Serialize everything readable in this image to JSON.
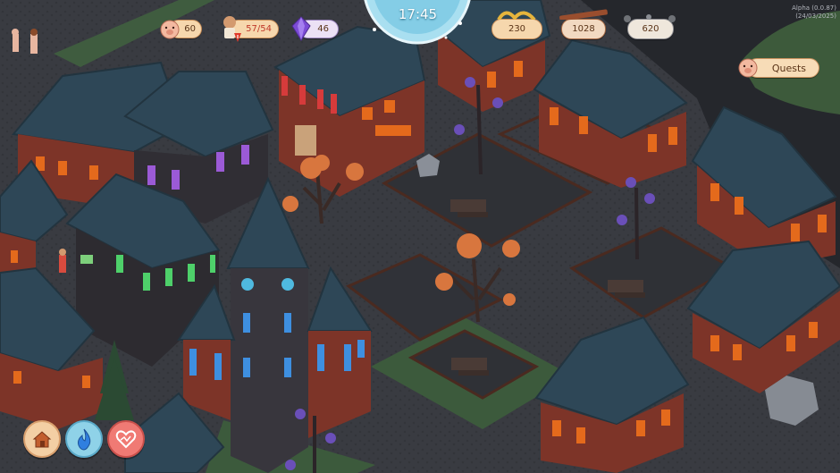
{
  "clock": {
    "time": "17:45"
  },
  "resources": {
    "population": {
      "icon": "pig-face-icon",
      "value": "60"
    },
    "workers": {
      "icon": "villager-alert-icon",
      "value": "57/54"
    },
    "gems": {
      "icon": "purple-gem-icon",
      "value": "46"
    },
    "wheat": {
      "icon": "wheat-icon",
      "value": "230"
    },
    "wood": {
      "icon": "wood-planks-icon",
      "value": "1028"
    },
    "stone": {
      "icon": "stone-pile-icon",
      "value": "620"
    }
  },
  "quests": {
    "label": "Quests",
    "icon": "pig-face-icon"
  },
  "version": {
    "line1": "Alpha (0.0.87)",
    "line2": "(24/03/2025)"
  },
  "bottom_bar": [
    {
      "name": "build-menu-button",
      "icon": "house-build-icon"
    },
    {
      "name": "spirit-button",
      "icon": "blue-flame-icon"
    },
    {
      "name": "happiness-button",
      "icon": "heart-chart-icon"
    }
  ],
  "colors": {
    "roof": "#2e4757",
    "brick": "#8e3a2c",
    "window_lit": "#e46a1c",
    "road": "#3a3c42",
    "grass": "#3f5c3f",
    "ui_pill": "#f6d7ad",
    "clock_face": "#a9dff0"
  }
}
